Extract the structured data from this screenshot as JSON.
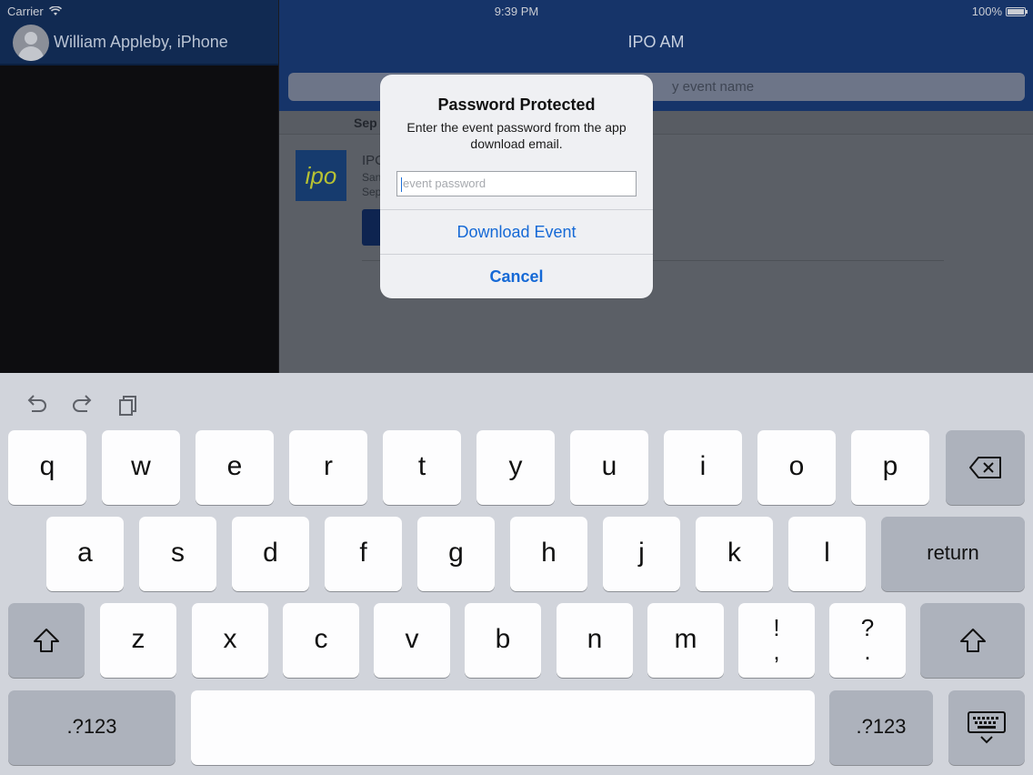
{
  "status_bar": {
    "carrier": "Carrier",
    "time": "9:39 PM",
    "battery": "100%"
  },
  "sidebar": {
    "user_name": "William Appleby, iPhone"
  },
  "main": {
    "title": "IPO AM",
    "search_placeholder": "y event name",
    "section_label": "Sep",
    "event": {
      "logo_text": "ipo",
      "name": "IPC",
      "line2": "San",
      "line3": "Sep"
    }
  },
  "alert": {
    "title": "Password Protected",
    "message": "Enter the event password from the app download email.",
    "input_placeholder": "event password",
    "primary_button": "Download Event",
    "cancel_button": "Cancel"
  },
  "keyboard": {
    "row1": [
      "q",
      "w",
      "e",
      "r",
      "t",
      "y",
      "u",
      "i",
      "o",
      "p"
    ],
    "row2": [
      "a",
      "s",
      "d",
      "f",
      "g",
      "h",
      "j",
      "k",
      "l"
    ],
    "row3": [
      "z",
      "x",
      "c",
      "v",
      "b",
      "n",
      "m"
    ],
    "return_label": "return",
    "numbers_label": ".?123",
    "punct1": {
      "top": "!",
      "bottom": ","
    },
    "punct2": {
      "top": "?",
      "bottom": "."
    },
    "icons": {
      "undo": "undo-icon",
      "redo": "redo-icon",
      "paste": "paste-icon",
      "delete": "backspace-icon",
      "shift": "shift-icon",
      "dismiss": "keyboard-dismiss-icon"
    }
  }
}
